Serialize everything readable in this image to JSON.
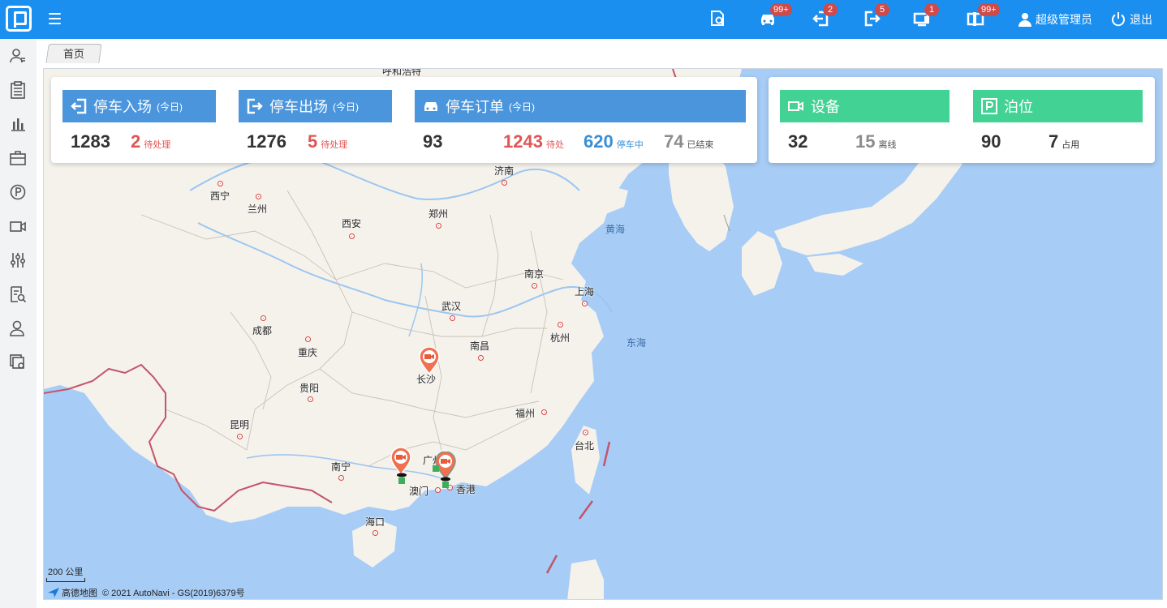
{
  "app": {
    "user_name": "超级管理员",
    "logout_label": "退出"
  },
  "top_badges": {
    "order": "99+",
    "enter": "2",
    "exit": "5",
    "device": "1",
    "berth": "99+"
  },
  "tabs": [
    {
      "label": "首页"
    }
  ],
  "stats": {
    "enter": {
      "title": "停车入场",
      "sub": "(今日)",
      "total": "1283",
      "pending": "2",
      "pending_label": "待处理"
    },
    "exit": {
      "title": "停车出场",
      "sub": "(今日)",
      "total": "1276",
      "pending": "5",
      "pending_label": "待处理"
    },
    "orders": {
      "title": "停车订单",
      "sub": "(今日)",
      "total": "93",
      "pending": "1243",
      "pending_label": "待处",
      "parking": "620",
      "parking_label": "停车中",
      "ended": "74",
      "ended_label": "已结束"
    },
    "device": {
      "title": "设备",
      "total": "32",
      "offline": "15",
      "offline_label": "离线"
    },
    "berth": {
      "title": "泊位",
      "total": "90",
      "occupied": "7",
      "occupied_label": "占用"
    }
  },
  "map": {
    "cities": [
      "呼和浩特",
      "西宁",
      "兰州",
      "西安",
      "郑州",
      "济南",
      "南京",
      "上海",
      "武汉",
      "杭州",
      "成都",
      "重庆",
      "南昌",
      "长沙",
      "贵阳",
      "福州",
      "昆明",
      "台北",
      "南宁",
      "广州",
      "澳门",
      "香港",
      "海口"
    ],
    "seas": [
      "黄海",
      "东海"
    ],
    "scale_label": "200 公里",
    "provider": "高德地图",
    "copyright": "© 2021 AutoNavi - GS(2019)6379号"
  },
  "colors": {
    "topbar": "#1a8ff0",
    "stat_blue": "#4a95dc",
    "stat_green": "#42d394",
    "alert_red": "#e05555",
    "sea": "#a7ccf5",
    "land": "#f5f2ec"
  }
}
